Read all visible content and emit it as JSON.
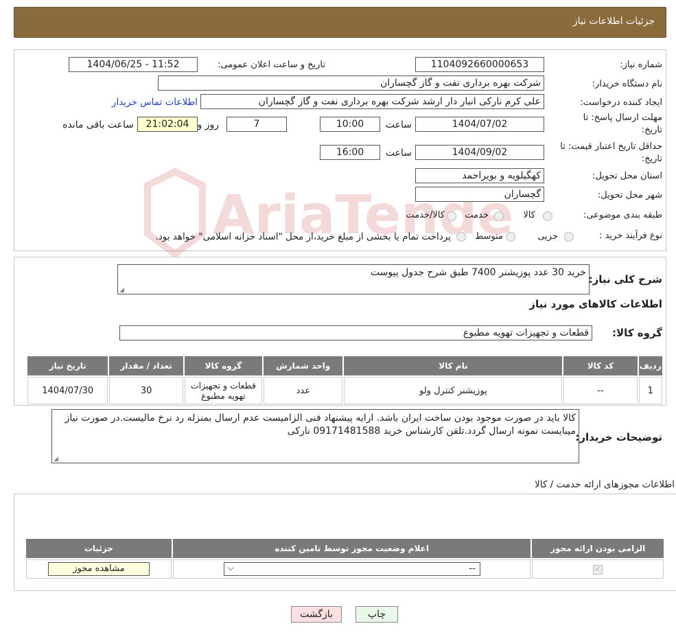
{
  "header": {
    "title": "جزئیات اطلاعات نیاز"
  },
  "form": {
    "need_number_label": "شماره نیاز:",
    "need_number": "1104092660000653",
    "announce_label": "تاریخ و ساعت اعلان عمومی:",
    "announce_value": "1404/06/25 - 11:52",
    "buyer_org_label": "نام دستگاه خریدار:",
    "buyer_org": "شرکت بهره برداری نفت و گاز گچساران",
    "creator_label": "ایجاد کننده درخواست:",
    "creator": "علی کرم نارکی انبار دار ارشد شرکت بهره برداری نفت و گاز گچساران",
    "contact_link": "اطلاعات تماس خریدار",
    "deadline_label_1": "مهلت ارسال پاسخ: تا",
    "deadline_label_2": "تاریخ:",
    "deadline_date": "1404/07/02",
    "time_label": "ساعت",
    "deadline_time": "10:00",
    "days_value": "7",
    "days_label": "روز و",
    "remaining_time": "21:02:04",
    "remaining_label": "ساعت باقی مانده",
    "validity_label_1": "حداقل تاریخ اعتبار قیمت: تا",
    "validity_label_2": "تاریخ:",
    "validity_date": "1404/09/02",
    "validity_time_label": "ساعت",
    "validity_time": "16:00",
    "province_label": "استان محل تحویل:",
    "province": "کهگیلویه و بویراحمد",
    "city_label": "شهر محل تحویل:",
    "city": "گچساران",
    "category_label": "طبقه بندی موضوعی:",
    "category_options": [
      "کالا",
      "خدمت",
      "کالا/خدمت"
    ],
    "process_label": "نوع فرآیند خرید :",
    "process_options": [
      "جزیی",
      "متوسط"
    ],
    "process_note": "پرداخت تمام یا بخشی از مبلغ خرید،از محل \"اسناد خزانه اسلامی\" خواهد بود."
  },
  "description": {
    "label": "شرح کلی نیاز:",
    "text": "خرید 30 عدد پوزیشنر 7400 طبق شرح جدول پیوست",
    "goods_title": "اطلاعات کالاهای مورد نیاز",
    "group_label": "گروه کالا:",
    "group_value": "قطعات و تجهیزات تهویه مطبوع"
  },
  "goods_table": {
    "headers": [
      "ردیف",
      "کد کالا",
      "نام کالا",
      "واحد شمارش",
      "گروه کالا",
      "تعداد / مقدار",
      "تاریخ نیاز"
    ],
    "rows": [
      [
        "1",
        "--",
        "پوزیشنر کنترل ولو",
        "عدد",
        "قطعات و تجهیزات تهویه مطبوع",
        "30",
        "1404/07/30"
      ]
    ]
  },
  "buyer_notes": {
    "label": "توضیحات خریدار:",
    "text": "کالا باید در صورت موجود بودن ساخت ایران باشد. ارایه پیشنهاد فنی الزامیست عدم ارسال بمنزله رد نرخ مالیست.در صورت نیاز میبایست نمونه ارسال گردد.تلفن کارشناس خرید 09171481588 نارکی"
  },
  "permits": {
    "title": "اطلاعات مجوزهای ارائه خدمت / کالا",
    "headers": [
      "الزامی بودن ارائه مجوز",
      "اعلام وضعیت مجوز توسط تامین کننده",
      "جزئیات"
    ],
    "select_value": "--",
    "view_button": "مشاهده مجوز"
  },
  "footer": {
    "print_label": "چاپ",
    "back_label": "بازگشت"
  },
  "watermark": {
    "brand": "AriaTender.neT",
    "color": "#c0392b"
  }
}
